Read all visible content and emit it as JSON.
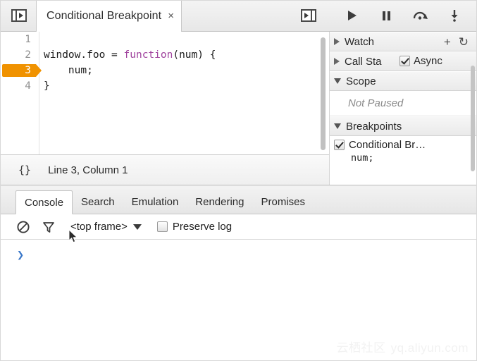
{
  "editor": {
    "panel_toggle_icon": "show-navigator-icon",
    "tab": {
      "label": "Conditional Breakpoint",
      "close_glyph": "×"
    },
    "code": {
      "lines": [
        {
          "num": "1",
          "text": "",
          "breakpoint": false
        },
        {
          "num": "2",
          "pre": "window.foo = ",
          "kw": "function",
          "post": "(num) {",
          "breakpoint": false
        },
        {
          "num": "3",
          "text": "    num;",
          "breakpoint": true
        },
        {
          "num": "4",
          "text": "}",
          "breakpoint": false
        }
      ],
      "breakpoint_color": "#f09200",
      "keyword_color": "#a0449e"
    },
    "status": {
      "pretty_print_glyph": "{}",
      "cursor_position": "Line 3, Column 1"
    }
  },
  "debugger": {
    "sidebar_toggle_icon": "show-debugger-icon",
    "toolbar": [
      {
        "name": "resume-button",
        "glyph": "▶",
        "title": "Resume script execution"
      },
      {
        "name": "pause-button",
        "glyph": "▐▌",
        "title": "Pause script execution"
      },
      {
        "name": "step-over-button",
        "glyph": "step-over",
        "title": "Step over next function call"
      },
      {
        "name": "step-into-button",
        "glyph": "step-into",
        "title": "Step into next function call"
      }
    ],
    "sections": {
      "watch": {
        "title": "Watch",
        "expanded": false,
        "add_glyph": "+",
        "refresh_glyph": "↻"
      },
      "call_stack": {
        "title": "Call Sta",
        "expanded": false,
        "async_label": "Async",
        "async_checked": true
      },
      "scope": {
        "title": "Scope",
        "expanded": true,
        "empty_text": "Not Paused"
      },
      "breakpoints": {
        "title": "Breakpoints",
        "expanded": true,
        "items": [
          {
            "name": "Conditional Br…",
            "condition": "num;",
            "checked": true
          }
        ]
      }
    }
  },
  "drawer": {
    "tabs": [
      {
        "label": "Console",
        "active": true
      },
      {
        "label": "Search",
        "active": false
      },
      {
        "label": "Emulation",
        "active": false
      },
      {
        "label": "Rendering",
        "active": false
      },
      {
        "label": "Promises",
        "active": false
      }
    ],
    "console_toolbar": {
      "clear_icon": "clear-console-icon",
      "filter_icon": "filter-icon",
      "frame_selector": "<top frame>",
      "preserve_log_label": "Preserve log",
      "preserve_log_checked": false
    },
    "console": {
      "prompt_glyph": "❯"
    }
  },
  "watermark": {
    "cn": "云栖社区",
    "url": "yq.aliyun.com"
  }
}
